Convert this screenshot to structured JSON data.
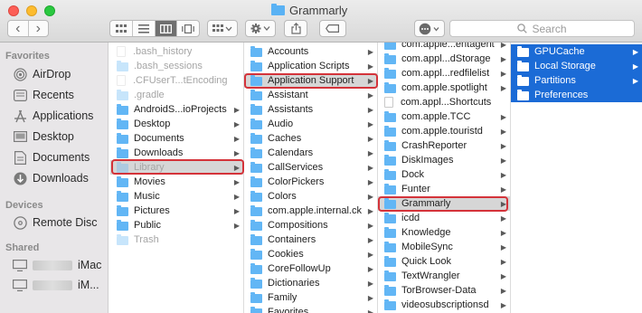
{
  "window": {
    "title": "Grammarly"
  },
  "toolbar": {
    "back": "‹",
    "forward": "›",
    "search_placeholder": "Search"
  },
  "icons": {
    "view_icon": "icon-view-icon",
    "view_list": "list-view-icon",
    "view_column": "column-view-icon",
    "view_gallery": "gallery-view-icon",
    "group": "group-icon",
    "action": "gear-icon",
    "share": "share-icon",
    "tags": "tag-icon",
    "more": "more-icon",
    "search": "search-icon"
  },
  "colors": {
    "selection_blue": "#1b6bd6",
    "highlight_red": "#d4333a",
    "folder_blue": "#62b6f5"
  },
  "sidebar": {
    "favorites_header": "Favorites",
    "favorites": [
      {
        "label": "AirDrop",
        "icon": "airdrop-icon"
      },
      {
        "label": "Recents",
        "icon": "recents-icon"
      },
      {
        "label": "Applications",
        "icon": "applications-icon"
      },
      {
        "label": "Desktop",
        "icon": "desktop-icon"
      },
      {
        "label": "Documents",
        "icon": "documents-icon"
      },
      {
        "label": "Downloads",
        "icon": "downloads-icon"
      }
    ],
    "devices_header": "Devices",
    "devices": [
      {
        "label": "Remote Disc",
        "icon": "disc-icon"
      }
    ],
    "shared_header": "Shared",
    "shared": [
      {
        "label": "iMac",
        "icon": "monitor-icon"
      },
      {
        "label": "iM...",
        "icon": "monitor-icon"
      }
    ]
  },
  "columns": {
    "home": [
      {
        "label": ".bash_history",
        "kind": "doc",
        "dim": true
      },
      {
        "label": ".bash_sessions",
        "kind": "folder",
        "dim": true
      },
      {
        "label": ".CFUserT...tEncoding",
        "kind": "doc",
        "dim": true
      },
      {
        "label": ".gradle",
        "kind": "folder",
        "dim": true
      },
      {
        "label": "AndroidS...ioProjects",
        "kind": "folder",
        "arrow": true
      },
      {
        "label": "Desktop",
        "kind": "folder",
        "arrow": true
      },
      {
        "label": "Documents",
        "kind": "folder",
        "arrow": true
      },
      {
        "label": "Downloads",
        "kind": "folder",
        "arrow": true
      },
      {
        "label": "Library",
        "kind": "folder",
        "arrow": true,
        "dim": true,
        "selected": true
      },
      {
        "label": "Movies",
        "kind": "folder",
        "arrow": true
      },
      {
        "label": "Music",
        "kind": "folder",
        "arrow": true
      },
      {
        "label": "Pictures",
        "kind": "folder",
        "arrow": true
      },
      {
        "label": "Public",
        "kind": "folder",
        "arrow": true
      },
      {
        "label": "Trash",
        "kind": "folder",
        "dim": true
      }
    ],
    "library": [
      {
        "label": "Accounts",
        "arrow": true
      },
      {
        "label": "Application Scripts",
        "arrow": true
      },
      {
        "label": "Application Support",
        "arrow": true,
        "selected": true
      },
      {
        "label": "Assistant",
        "arrow": true
      },
      {
        "label": "Assistants",
        "arrow": true
      },
      {
        "label": "Audio",
        "arrow": true
      },
      {
        "label": "Caches",
        "arrow": true
      },
      {
        "label": "Calendars",
        "arrow": true
      },
      {
        "label": "CallServices",
        "arrow": true
      },
      {
        "label": "ColorPickers",
        "arrow": true
      },
      {
        "label": "Colors",
        "arrow": true
      },
      {
        "label": "com.apple.internal.ck",
        "arrow": true
      },
      {
        "label": "Compositions",
        "arrow": true
      },
      {
        "label": "Containers",
        "arrow": true
      },
      {
        "label": "Cookies",
        "arrow": true
      },
      {
        "label": "CoreFollowUp",
        "arrow": true
      },
      {
        "label": "Dictionaries",
        "arrow": true
      },
      {
        "label": "Family",
        "arrow": true
      },
      {
        "label": "Favorites",
        "arrow": true
      }
    ],
    "app_support": [
      {
        "label": "com.apple...entagent",
        "arrow": true
      },
      {
        "label": "com.appl...dStorage",
        "arrow": true
      },
      {
        "label": "com.appl...redfilelist",
        "arrow": true
      },
      {
        "label": "com.apple.spotlight",
        "arrow": true
      },
      {
        "label": "com.appl...Shortcuts",
        "kind": "doc"
      },
      {
        "label": "com.apple.TCC",
        "arrow": true
      },
      {
        "label": "com.apple.touristd",
        "arrow": true
      },
      {
        "label": "CrashReporter",
        "arrow": true
      },
      {
        "label": "DiskImages",
        "arrow": true
      },
      {
        "label": "Dock",
        "arrow": true
      },
      {
        "label": "Funter",
        "arrow": true
      },
      {
        "label": "Grammarly",
        "arrow": true,
        "selected": true
      },
      {
        "label": "icdd",
        "arrow": true
      },
      {
        "label": "Knowledge",
        "arrow": true
      },
      {
        "label": "MobileSync",
        "arrow": true
      },
      {
        "label": "Quick Look",
        "arrow": true
      },
      {
        "label": "TextWrangler",
        "arrow": true
      },
      {
        "label": "TorBrowser-Data",
        "arrow": true
      },
      {
        "label": "videosubscriptionsd",
        "arrow": true
      }
    ],
    "grammarly": [
      {
        "label": "GPUCache",
        "arrow": true
      },
      {
        "label": "Local Storage",
        "arrow": true
      },
      {
        "label": "Partitions",
        "arrow": true
      },
      {
        "label": "Preferences"
      }
    ]
  }
}
